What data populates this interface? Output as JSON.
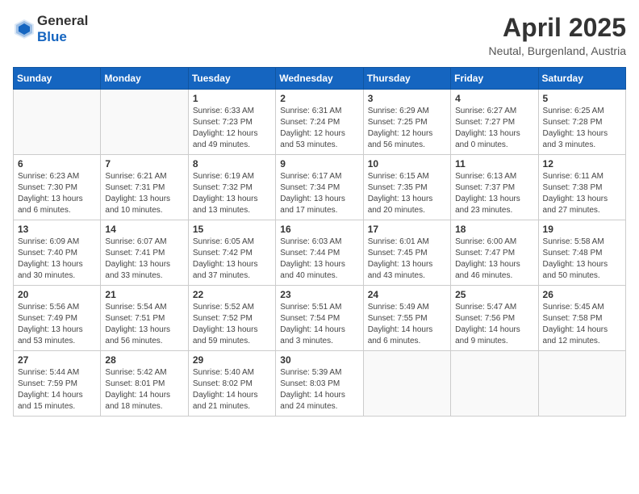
{
  "header": {
    "logo_general": "General",
    "logo_blue": "Blue",
    "month_year": "April 2025",
    "location": "Neutal, Burgenland, Austria"
  },
  "days_of_week": [
    "Sunday",
    "Monday",
    "Tuesday",
    "Wednesday",
    "Thursday",
    "Friday",
    "Saturday"
  ],
  "weeks": [
    [
      {
        "day": "",
        "info": ""
      },
      {
        "day": "",
        "info": ""
      },
      {
        "day": "1",
        "info": "Sunrise: 6:33 AM\nSunset: 7:23 PM\nDaylight: 12 hours\nand 49 minutes."
      },
      {
        "day": "2",
        "info": "Sunrise: 6:31 AM\nSunset: 7:24 PM\nDaylight: 12 hours\nand 53 minutes."
      },
      {
        "day": "3",
        "info": "Sunrise: 6:29 AM\nSunset: 7:25 PM\nDaylight: 12 hours\nand 56 minutes."
      },
      {
        "day": "4",
        "info": "Sunrise: 6:27 AM\nSunset: 7:27 PM\nDaylight: 13 hours\nand 0 minutes."
      },
      {
        "day": "5",
        "info": "Sunrise: 6:25 AM\nSunset: 7:28 PM\nDaylight: 13 hours\nand 3 minutes."
      }
    ],
    [
      {
        "day": "6",
        "info": "Sunrise: 6:23 AM\nSunset: 7:30 PM\nDaylight: 13 hours\nand 6 minutes."
      },
      {
        "day": "7",
        "info": "Sunrise: 6:21 AM\nSunset: 7:31 PM\nDaylight: 13 hours\nand 10 minutes."
      },
      {
        "day": "8",
        "info": "Sunrise: 6:19 AM\nSunset: 7:32 PM\nDaylight: 13 hours\nand 13 minutes."
      },
      {
        "day": "9",
        "info": "Sunrise: 6:17 AM\nSunset: 7:34 PM\nDaylight: 13 hours\nand 17 minutes."
      },
      {
        "day": "10",
        "info": "Sunrise: 6:15 AM\nSunset: 7:35 PM\nDaylight: 13 hours\nand 20 minutes."
      },
      {
        "day": "11",
        "info": "Sunrise: 6:13 AM\nSunset: 7:37 PM\nDaylight: 13 hours\nand 23 minutes."
      },
      {
        "day": "12",
        "info": "Sunrise: 6:11 AM\nSunset: 7:38 PM\nDaylight: 13 hours\nand 27 minutes."
      }
    ],
    [
      {
        "day": "13",
        "info": "Sunrise: 6:09 AM\nSunset: 7:40 PM\nDaylight: 13 hours\nand 30 minutes."
      },
      {
        "day": "14",
        "info": "Sunrise: 6:07 AM\nSunset: 7:41 PM\nDaylight: 13 hours\nand 33 minutes."
      },
      {
        "day": "15",
        "info": "Sunrise: 6:05 AM\nSunset: 7:42 PM\nDaylight: 13 hours\nand 37 minutes."
      },
      {
        "day": "16",
        "info": "Sunrise: 6:03 AM\nSunset: 7:44 PM\nDaylight: 13 hours\nand 40 minutes."
      },
      {
        "day": "17",
        "info": "Sunrise: 6:01 AM\nSunset: 7:45 PM\nDaylight: 13 hours\nand 43 minutes."
      },
      {
        "day": "18",
        "info": "Sunrise: 6:00 AM\nSunset: 7:47 PM\nDaylight: 13 hours\nand 46 minutes."
      },
      {
        "day": "19",
        "info": "Sunrise: 5:58 AM\nSunset: 7:48 PM\nDaylight: 13 hours\nand 50 minutes."
      }
    ],
    [
      {
        "day": "20",
        "info": "Sunrise: 5:56 AM\nSunset: 7:49 PM\nDaylight: 13 hours\nand 53 minutes."
      },
      {
        "day": "21",
        "info": "Sunrise: 5:54 AM\nSunset: 7:51 PM\nDaylight: 13 hours\nand 56 minutes."
      },
      {
        "day": "22",
        "info": "Sunrise: 5:52 AM\nSunset: 7:52 PM\nDaylight: 13 hours\nand 59 minutes."
      },
      {
        "day": "23",
        "info": "Sunrise: 5:51 AM\nSunset: 7:54 PM\nDaylight: 14 hours\nand 3 minutes."
      },
      {
        "day": "24",
        "info": "Sunrise: 5:49 AM\nSunset: 7:55 PM\nDaylight: 14 hours\nand 6 minutes."
      },
      {
        "day": "25",
        "info": "Sunrise: 5:47 AM\nSunset: 7:56 PM\nDaylight: 14 hours\nand 9 minutes."
      },
      {
        "day": "26",
        "info": "Sunrise: 5:45 AM\nSunset: 7:58 PM\nDaylight: 14 hours\nand 12 minutes."
      }
    ],
    [
      {
        "day": "27",
        "info": "Sunrise: 5:44 AM\nSunset: 7:59 PM\nDaylight: 14 hours\nand 15 minutes."
      },
      {
        "day": "28",
        "info": "Sunrise: 5:42 AM\nSunset: 8:01 PM\nDaylight: 14 hours\nand 18 minutes."
      },
      {
        "day": "29",
        "info": "Sunrise: 5:40 AM\nSunset: 8:02 PM\nDaylight: 14 hours\nand 21 minutes."
      },
      {
        "day": "30",
        "info": "Sunrise: 5:39 AM\nSunset: 8:03 PM\nDaylight: 14 hours\nand 24 minutes."
      },
      {
        "day": "",
        "info": ""
      },
      {
        "day": "",
        "info": ""
      },
      {
        "day": "",
        "info": ""
      }
    ]
  ]
}
